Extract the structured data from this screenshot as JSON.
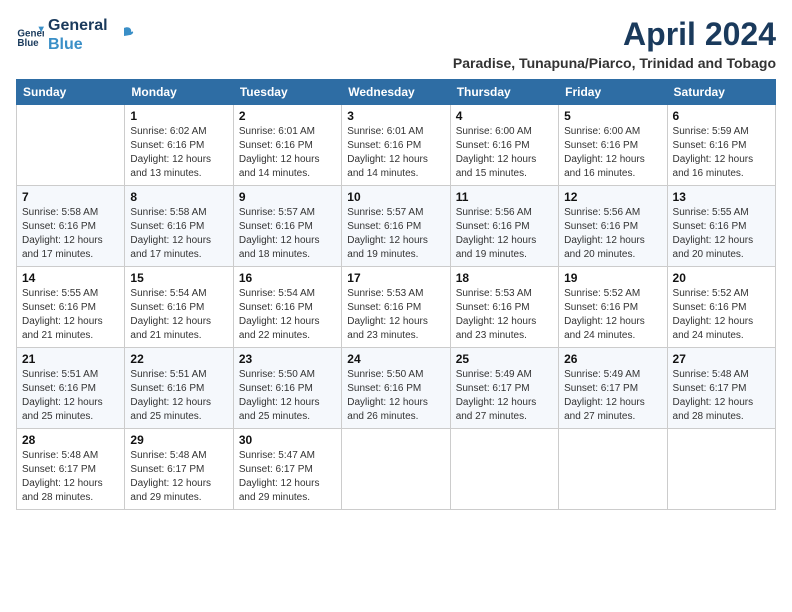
{
  "logo": {
    "line1": "General",
    "line2": "Blue"
  },
  "title": "April 2024",
  "subtitle": "Paradise, Tunapuna/Piarco, Trinidad and Tobago",
  "days_of_week": [
    "Sunday",
    "Monday",
    "Tuesday",
    "Wednesday",
    "Thursday",
    "Friday",
    "Saturday"
  ],
  "weeks": [
    [
      {
        "day": null
      },
      {
        "day": 1,
        "sunrise": "6:02 AM",
        "sunset": "6:16 PM",
        "daylight": "12 hours and 13 minutes."
      },
      {
        "day": 2,
        "sunrise": "6:01 AM",
        "sunset": "6:16 PM",
        "daylight": "12 hours and 14 minutes."
      },
      {
        "day": 3,
        "sunrise": "6:01 AM",
        "sunset": "6:16 PM",
        "daylight": "12 hours and 14 minutes."
      },
      {
        "day": 4,
        "sunrise": "6:00 AM",
        "sunset": "6:16 PM",
        "daylight": "12 hours and 15 minutes."
      },
      {
        "day": 5,
        "sunrise": "6:00 AM",
        "sunset": "6:16 PM",
        "daylight": "12 hours and 16 minutes."
      },
      {
        "day": 6,
        "sunrise": "5:59 AM",
        "sunset": "6:16 PM",
        "daylight": "12 hours and 16 minutes."
      }
    ],
    [
      {
        "day": 7,
        "sunrise": "5:58 AM",
        "sunset": "6:16 PM",
        "daylight": "12 hours and 17 minutes."
      },
      {
        "day": 8,
        "sunrise": "5:58 AM",
        "sunset": "6:16 PM",
        "daylight": "12 hours and 17 minutes."
      },
      {
        "day": 9,
        "sunrise": "5:57 AM",
        "sunset": "6:16 PM",
        "daylight": "12 hours and 18 minutes."
      },
      {
        "day": 10,
        "sunrise": "5:57 AM",
        "sunset": "6:16 PM",
        "daylight": "12 hours and 19 minutes."
      },
      {
        "day": 11,
        "sunrise": "5:56 AM",
        "sunset": "6:16 PM",
        "daylight": "12 hours and 19 minutes."
      },
      {
        "day": 12,
        "sunrise": "5:56 AM",
        "sunset": "6:16 PM",
        "daylight": "12 hours and 20 minutes."
      },
      {
        "day": 13,
        "sunrise": "5:55 AM",
        "sunset": "6:16 PM",
        "daylight": "12 hours and 20 minutes."
      }
    ],
    [
      {
        "day": 14,
        "sunrise": "5:55 AM",
        "sunset": "6:16 PM",
        "daylight": "12 hours and 21 minutes."
      },
      {
        "day": 15,
        "sunrise": "5:54 AM",
        "sunset": "6:16 PM",
        "daylight": "12 hours and 21 minutes."
      },
      {
        "day": 16,
        "sunrise": "5:54 AM",
        "sunset": "6:16 PM",
        "daylight": "12 hours and 22 minutes."
      },
      {
        "day": 17,
        "sunrise": "5:53 AM",
        "sunset": "6:16 PM",
        "daylight": "12 hours and 23 minutes."
      },
      {
        "day": 18,
        "sunrise": "5:53 AM",
        "sunset": "6:16 PM",
        "daylight": "12 hours and 23 minutes."
      },
      {
        "day": 19,
        "sunrise": "5:52 AM",
        "sunset": "6:16 PM",
        "daylight": "12 hours and 24 minutes."
      },
      {
        "day": 20,
        "sunrise": "5:52 AM",
        "sunset": "6:16 PM",
        "daylight": "12 hours and 24 minutes."
      }
    ],
    [
      {
        "day": 21,
        "sunrise": "5:51 AM",
        "sunset": "6:16 PM",
        "daylight": "12 hours and 25 minutes."
      },
      {
        "day": 22,
        "sunrise": "5:51 AM",
        "sunset": "6:16 PM",
        "daylight": "12 hours and 25 minutes."
      },
      {
        "day": 23,
        "sunrise": "5:50 AM",
        "sunset": "6:16 PM",
        "daylight": "12 hours and 25 minutes."
      },
      {
        "day": 24,
        "sunrise": "5:50 AM",
        "sunset": "6:16 PM",
        "daylight": "12 hours and 26 minutes."
      },
      {
        "day": 25,
        "sunrise": "5:49 AM",
        "sunset": "6:17 PM",
        "daylight": "12 hours and 27 minutes."
      },
      {
        "day": 26,
        "sunrise": "5:49 AM",
        "sunset": "6:17 PM",
        "daylight": "12 hours and 27 minutes."
      },
      {
        "day": 27,
        "sunrise": "5:48 AM",
        "sunset": "6:17 PM",
        "daylight": "12 hours and 28 minutes."
      }
    ],
    [
      {
        "day": 28,
        "sunrise": "5:48 AM",
        "sunset": "6:17 PM",
        "daylight": "12 hours and 28 minutes."
      },
      {
        "day": 29,
        "sunrise": "5:48 AM",
        "sunset": "6:17 PM",
        "daylight": "12 hours and 29 minutes."
      },
      {
        "day": 30,
        "sunrise": "5:47 AM",
        "sunset": "6:17 PM",
        "daylight": "12 hours and 29 minutes."
      },
      {
        "day": null
      },
      {
        "day": null
      },
      {
        "day": null
      },
      {
        "day": null
      }
    ]
  ]
}
